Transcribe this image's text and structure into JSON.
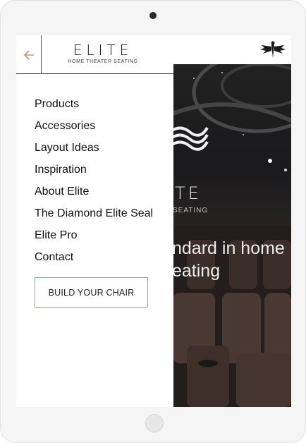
{
  "brand": {
    "name": "ELITE",
    "subtitle": "HOME THEATER SEATING"
  },
  "menu": {
    "items": [
      {
        "label": "Products"
      },
      {
        "label": "Accessories"
      },
      {
        "label": "Layout Ideas"
      },
      {
        "label": "Inspiration"
      },
      {
        "label": "About Elite"
      },
      {
        "label": "The Diamond Elite Seal"
      },
      {
        "label": "Elite Pro"
      },
      {
        "label": "Contact"
      }
    ],
    "cta_label": "BUILD YOUR CHAIR"
  },
  "hero": {
    "brand_fragment": "ITE",
    "subtitle_fragment": "SEATING",
    "tagline_fragment": "ndard in home eating"
  },
  "colors": {
    "accent": "#b59a82",
    "text": "#111111",
    "hero_background": "#1c1818"
  },
  "icons": {
    "back": "arrow-left-icon",
    "emblem": "eagle-emblem-icon"
  }
}
